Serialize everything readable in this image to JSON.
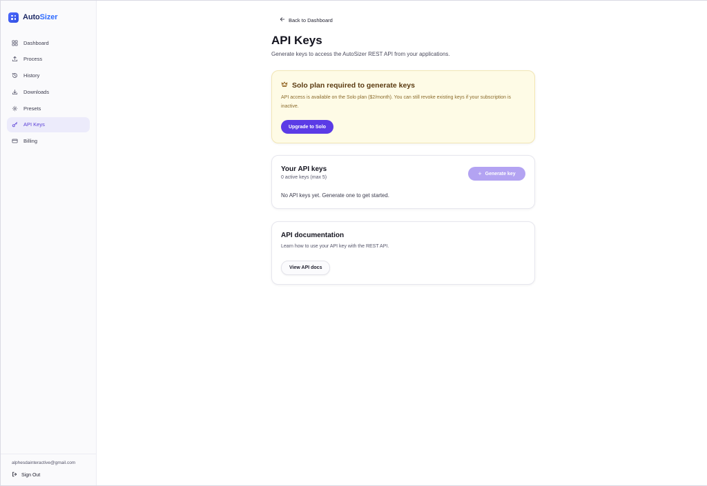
{
  "brand": {
    "name_part1": "Auto",
    "name_part2": "Sizer"
  },
  "sidebar": {
    "items": [
      {
        "label": "Dashboard",
        "icon": "dashboard-icon"
      },
      {
        "label": "Process",
        "icon": "upload-icon"
      },
      {
        "label": "History",
        "icon": "history-icon"
      },
      {
        "label": "Downloads",
        "icon": "download-icon"
      },
      {
        "label": "Presets",
        "icon": "gear-icon"
      },
      {
        "label": "API Keys",
        "icon": "key-icon",
        "active": true
      },
      {
        "label": "Billing",
        "icon": "credit-card-icon"
      }
    ],
    "user_email": "alphesdainteractive@gmail.com",
    "sign_out_label": "Sign Out"
  },
  "header": {
    "back_label": "Back to Dashboard",
    "title": "API Keys",
    "subtitle": "Generate keys to access the AutoSizer REST API from your applications."
  },
  "plan_notice": {
    "icon": "crown-icon",
    "title": "Solo plan required to generate keys",
    "text": "API access is available on the Solo plan ($2/month). You can still revoke existing keys if your subscription is inactive.",
    "button_label": "Upgrade to Solo"
  },
  "keys_card": {
    "title": "Your API keys",
    "count_text": "0 active keys (max 5)",
    "generate_label": "Generate key",
    "empty_text": "No API keys yet. Generate one to get started."
  },
  "docs_card": {
    "title": "API documentation",
    "description": "Learn how to use your API key with the REST API.",
    "button_label": "View API docs"
  },
  "colors": {
    "accent": "#5b3be6",
    "accent_disabled": "#b3a3f2",
    "active_nav_bg": "#ecebfb",
    "warning_bg": "#fefbe6",
    "brand_blue": "#2f6bff"
  }
}
